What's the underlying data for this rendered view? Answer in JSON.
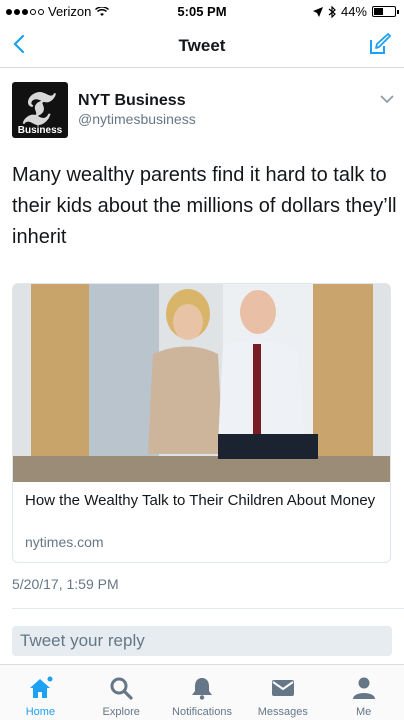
{
  "status_bar": {
    "carrier": "Verizon",
    "time": "5:05 PM",
    "battery": "44%",
    "battery_level": 0.44
  },
  "nav": {
    "title": "Tweet"
  },
  "tweet": {
    "author_name": "NYT Business",
    "author_handle": "@nytimesbusiness",
    "avatar_label": "Business",
    "text": "Many wealthy parents find it hard to talk to their kids about the millions of dollars they’ll inherit",
    "timestamp": "5/20/17, 1:59 PM"
  },
  "card": {
    "title": "How the Wealthy Talk to Their Children About Money",
    "domain": "nytimes.com"
  },
  "reply": {
    "placeholder": "Tweet your reply"
  },
  "tabs": [
    {
      "label": "Home",
      "icon": "home-icon",
      "active": true
    },
    {
      "label": "Explore",
      "icon": "search-icon",
      "active": false
    },
    {
      "label": "Notifications",
      "icon": "bell-icon",
      "active": false
    },
    {
      "label": "Messages",
      "icon": "envelope-icon",
      "active": false
    },
    {
      "label": "Me",
      "icon": "person-icon",
      "active": false
    }
  ],
  "colors": {
    "accent": "#1da1f2",
    "text": "#14171a",
    "secondary": "#657786"
  }
}
